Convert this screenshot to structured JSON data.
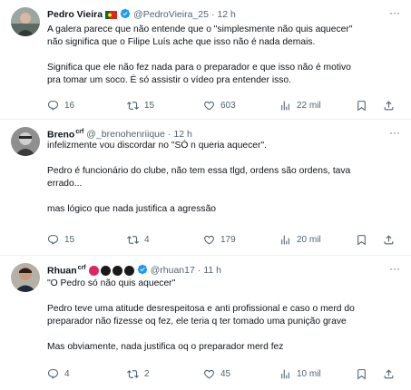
{
  "colors": {
    "text": "#0f1419",
    "muted": "#536471",
    "verified": "#1d9bf0",
    "divider": "#eff3f4"
  },
  "tweets": [
    {
      "name": "Pedro Vieira",
      "handle": "@PedroVieira_25",
      "dot": "·",
      "time": "12 h",
      "more": "···",
      "lines": [
        "A galera parece que não entende que o \"simplesmente não quis aquecer\"",
        "não significa que o Filipe Luís ache que isso não é nada demais.",
        "",
        "Significa que ele não fez nada para o preparador e que isso não é motivo",
        "pra tomar um soco. É só assistir o vídeo pra entender isso."
      ],
      "replies": "16",
      "retweets": "15",
      "likes": "603",
      "views": "22 mil"
    },
    {
      "name": "Breno",
      "name_sup": "crf",
      "handle": "@_brenohenriique",
      "dot": "·",
      "time": "12 h",
      "more": "···",
      "lines": [
        "infelizmente vou discordar no \"SÓ n queria aquecer\".",
        "",
        "Pedro é funcionário do clube, não tem essa tlgd, ordens são ordens, tava",
        "errado...",
        "",
        "mas lógico que nada justifica a agressão"
      ],
      "replies": "15",
      "retweets": "4",
      "likes": "179",
      "views": "20 mil"
    },
    {
      "name": "Rhuan",
      "name_sup": "crf",
      "handle": "@rhuan17",
      "dot": "·",
      "time": "11 h",
      "more": "···",
      "lines": [
        "\"O Pedro só não quis aquecer\"",
        "",
        "Pedro teve uma atitude desrespeitosa e anti profissional e caso o merd do",
        "preparador não fizesse oq fez, ele teria q ter tomado uma punição grave",
        "",
        "Mas obviamente, nada justifica oq o preparador merd fez"
      ],
      "replies": "4",
      "retweets": "2",
      "likes": "45",
      "views": "10 mil"
    }
  ]
}
